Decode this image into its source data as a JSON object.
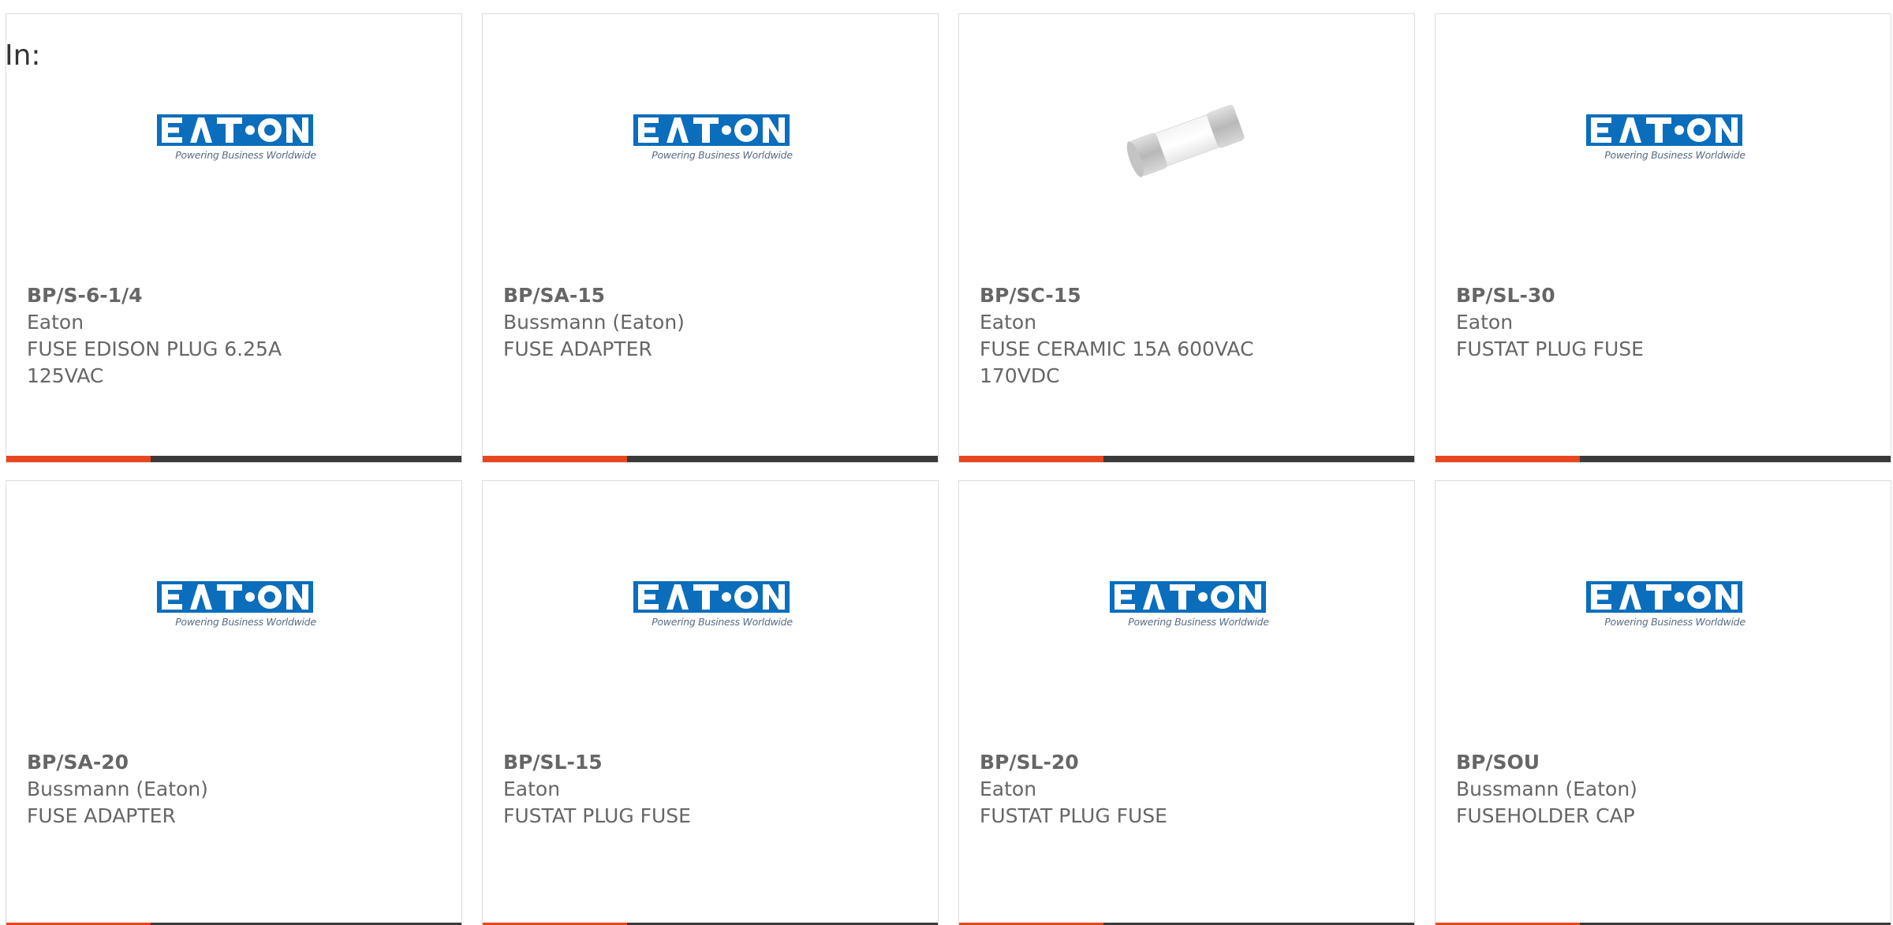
{
  "filter": {
    "label": "In:"
  },
  "logo": {
    "text": "EATON",
    "tagline": "Powering Business Worldwide",
    "brand_color": "#0a6ebd"
  },
  "colors": {
    "accent": "#e8461e",
    "bar": "#3a3a3a",
    "text": "#666666",
    "border": "#dcdcdc"
  },
  "products": [
    {
      "part": "BP/S-6-1/4",
      "manufacturer": "Eaton",
      "description": "FUSE EDISON PLUG 6.25A 125VAC",
      "image": "eaton-logo"
    },
    {
      "part": "BP/SA-15",
      "manufacturer": "Bussmann (Eaton)",
      "description": "FUSE ADAPTER",
      "image": "eaton-logo"
    },
    {
      "part": "BP/SC-15",
      "manufacturer": "Eaton",
      "description": "FUSE CERAMIC 15A 600VAC 170VDC",
      "image": "cartridge-fuse-photo"
    },
    {
      "part": "BP/SL-30",
      "manufacturer": "Eaton",
      "description": "FUSTAT PLUG FUSE",
      "image": "eaton-logo"
    },
    {
      "part": "BP/SA-20",
      "manufacturer": "Bussmann (Eaton)",
      "description": "FUSE ADAPTER",
      "image": "eaton-logo"
    },
    {
      "part": "BP/SL-15",
      "manufacturer": "Eaton",
      "description": "FUSTAT PLUG FUSE",
      "image": "eaton-logo"
    },
    {
      "part": "BP/SL-20",
      "manufacturer": "Eaton",
      "description": "FUSTAT PLUG FUSE",
      "image": "eaton-logo"
    },
    {
      "part": "BP/SOU",
      "manufacturer": "Bussmann (Eaton)",
      "description": "FUSEHOLDER CAP",
      "image": "eaton-logo"
    }
  ]
}
